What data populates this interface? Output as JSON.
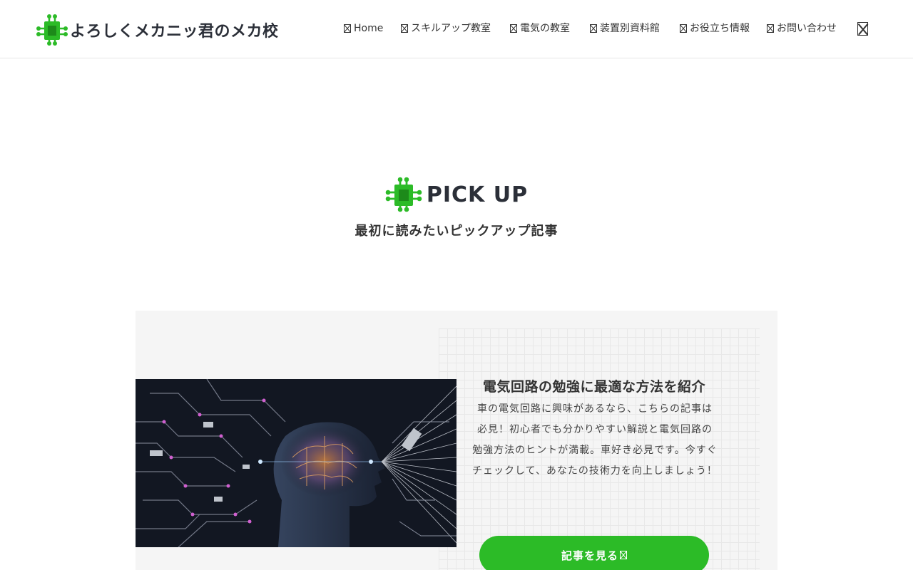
{
  "site": {
    "logo_icon": "circuit-chip-icon",
    "logo_text": "よろしくメカニッ君のメカ校",
    "brand_color": "#2cbb27"
  },
  "nav": {
    "items": [
      {
        "label": "Home",
        "icon": "missing-glyph-icon"
      },
      {
        "label": "スキルアップ教室",
        "icon": "missing-glyph-icon"
      },
      {
        "label": "電気の教室",
        "icon": "missing-glyph-icon"
      },
      {
        "label": "装置別資料館",
        "icon": "missing-glyph-icon"
      },
      {
        "label": "お役立ち情報",
        "icon": "missing-glyph-icon"
      },
      {
        "label": "お問い合わせ",
        "icon": "missing-glyph-icon"
      }
    ],
    "extra_icon": "missing-glyph-icon"
  },
  "pickup": {
    "icon": "circuit-chip-icon",
    "title": "PICK UP",
    "subtitle": "最初に読みたいピックアップ記事"
  },
  "article": {
    "image": "ai-brain-circuit-image",
    "title": "電気回路の勉強に最適な方法を紹介",
    "description": "車の電気回路に興味があるなら、こちらの記事は必見！初心者でも分かりやすい解説と電気回路の勉強方法のヒントが満載。車好き必見です。今すぐチェックして、あなたの技術力を向上しましょう！",
    "button_label": "記事を見る",
    "button_icon": "missing-glyph-icon"
  }
}
